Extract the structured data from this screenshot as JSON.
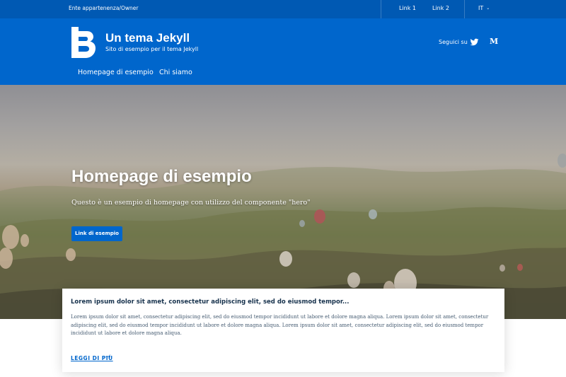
{
  "slim_header": {
    "owner": "Ente appartenenza/Owner",
    "links": [
      "Link 1",
      "Link 2"
    ],
    "language": "IT"
  },
  "center_header": {
    "title": "Un tema Jekyll",
    "subtitle": "Sito di esempio per il tema Jekyll",
    "social_label": "Seguici su",
    "social_icons": [
      "twitter-icon",
      "medium-icon"
    ]
  },
  "nav": {
    "items": [
      "Homepage di esempio",
      "Chi siamo"
    ]
  },
  "hero": {
    "title": "Homepage di esempio",
    "text": "Questo è un esempio di homepage con utilizzo del componente \"hero\"",
    "button": "Link di esempio"
  },
  "card": {
    "title": "Lorem ipsum dolor sit amet, consectetur adipiscing elit, sed do eiusmod tempor...",
    "body": "Lorem ipsum dolor sit amet, consectetur adipiscing elit, sed do eiusmod tempor incididunt ut labore et dolore magna aliqua. Lorem ipsum dolor sit amet, consectetur adipiscing elit, sed do eiusmod tempor incididunt ut labore et dolore magna aliqua. Lorem ipsum dolor sit amet, consectetur adipiscing elit, sed do eiusmod tempor incididunt ut labore et dolore magna aliqua.",
    "more": "LEGGI DI PIÙ"
  },
  "colors": {
    "slim": "#0059b3",
    "primary": "#0066cc",
    "text": "#17324d"
  }
}
